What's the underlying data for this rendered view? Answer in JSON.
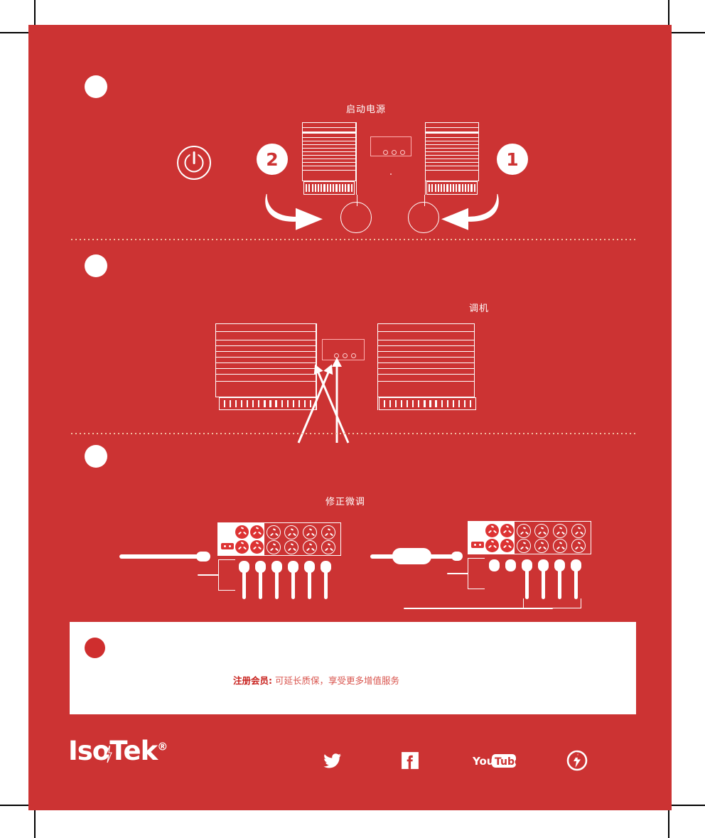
{
  "page": {
    "background_color": "#cc3333",
    "accent_white": "#ffffff",
    "brand_red": "#c8201c"
  },
  "sections": [
    {
      "id": "startup",
      "bullet": "bullet-1",
      "heading": "启动电源",
      "step_labels": [
        "1",
        "2"
      ],
      "power_icon": "power-icon"
    },
    {
      "id": "tuning",
      "bullet": "bullet-2",
      "heading": "调机"
    },
    {
      "id": "fine-adjust",
      "bullet": "bullet-3",
      "heading": "修正微调"
    }
  ],
  "info_box": {
    "bullet": "bullet-4",
    "registration_bold": "注册会员:",
    "registration_text": " 可延长质保，享受更多增值服务"
  },
  "footer": {
    "logo_text": "IsoTek",
    "logo_trademark": "®",
    "social": [
      {
        "name": "twitter-icon",
        "glyph": "twitter"
      },
      {
        "name": "facebook-icon",
        "glyph": "facebook"
      },
      {
        "name": "youtube-icon",
        "label_you": "You",
        "label_tube": "Tube"
      },
      {
        "name": "isotek-circle-icon",
        "glyph": "isotek"
      }
    ]
  },
  "device": {
    "display_dots": 3,
    "vent_count": 16
  },
  "outlets": {
    "left_strip": {
      "white_sockets": 4,
      "red_sockets": 8,
      "fuse": true
    },
    "right_strip": {
      "white_sockets": 4,
      "red_sockets": 8,
      "fuse": true
    },
    "left_plugs": 6,
    "right_plugs": 6
  }
}
